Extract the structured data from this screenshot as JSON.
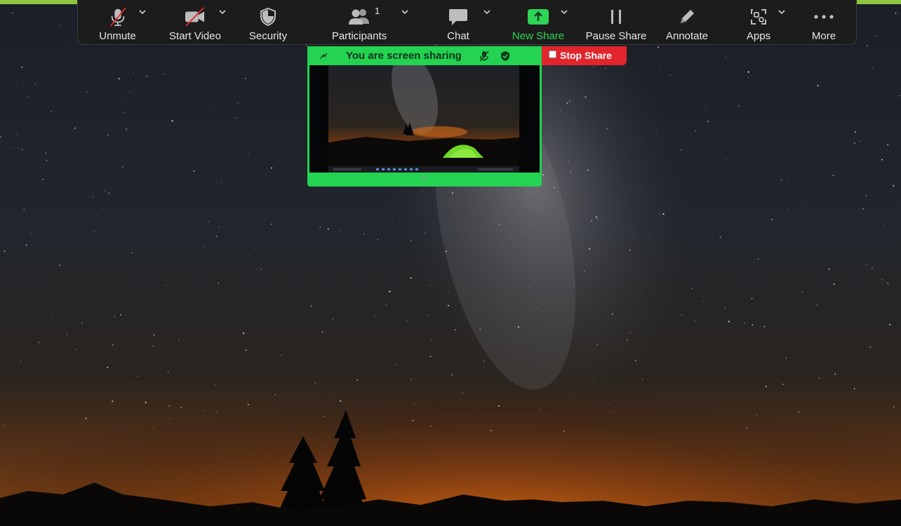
{
  "toolbar": {
    "unmute": {
      "label": "Unmute",
      "icon": "microphone-muted-icon"
    },
    "start_video": {
      "label": "Start Video",
      "icon": "video-camera-off-icon"
    },
    "security": {
      "label": "Security",
      "icon": "shield-icon"
    },
    "participants": {
      "label": "Participants",
      "count": "1",
      "icon": "participants-icon"
    },
    "chat": {
      "label": "Chat",
      "icon": "chat-bubble-icon"
    },
    "new_share": {
      "label": "New Share",
      "icon": "share-up-arrow-icon"
    },
    "pause_share": {
      "label": "Pause Share",
      "icon": "pause-icon"
    },
    "annotate": {
      "label": "Annotate",
      "icon": "pencil-icon"
    },
    "apps": {
      "label": "Apps",
      "icon": "apps-icon"
    },
    "more": {
      "label": "More",
      "icon": "more-dots-icon"
    }
  },
  "share_panel": {
    "title": "You are screen sharing",
    "stop_label": "Stop Share"
  },
  "colors": {
    "share_green": "#23d351",
    "stop_red": "#e2252b",
    "toolbar_bg": "#1c1c1c",
    "active_label": "#2fd456"
  }
}
